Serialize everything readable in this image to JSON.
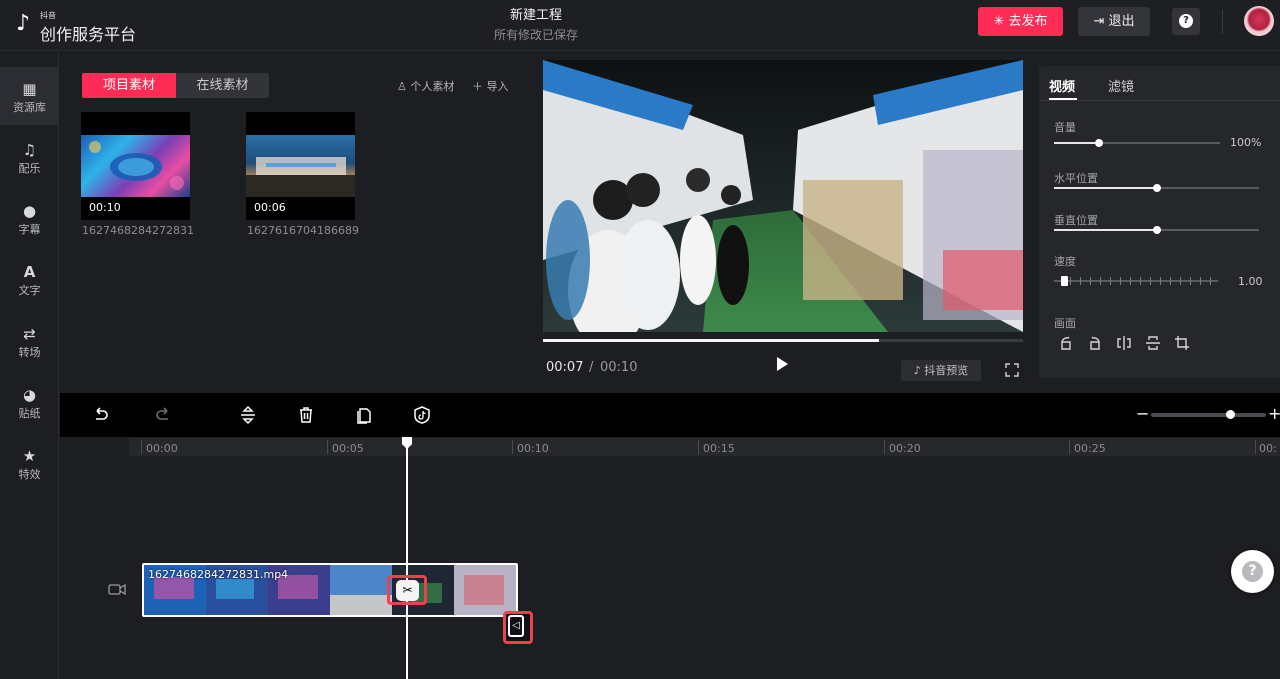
{
  "header": {
    "logo_small": "抖音",
    "logo_text": "创作服务平台",
    "project_title": "新建工程",
    "save_status": "所有修改已保存",
    "publish_label": "去发布",
    "exit_label": "退出",
    "help_glyph": "?",
    "accent_color": "#fe2c55"
  },
  "sidebar": {
    "items": [
      {
        "label": "资源库",
        "icon": "grid-icon"
      },
      {
        "label": "配乐",
        "icon": "music-icon"
      },
      {
        "label": "字幕",
        "icon": "subtitle-icon"
      },
      {
        "label": "文字",
        "icon": "text-icon"
      },
      {
        "label": "转场",
        "icon": "transition-icon"
      },
      {
        "label": "贴纸",
        "icon": "sticker-icon"
      },
      {
        "label": "特效",
        "icon": "effects-icon"
      }
    ]
  },
  "materials": {
    "tabs": [
      "项目素材",
      "在线素材"
    ],
    "personal_label": "个人素材",
    "import_label": "导入",
    "items": [
      {
        "duration": "00:10",
        "name": "1627468284272831"
      },
      {
        "duration": "00:06",
        "name": "1627616704186689"
      }
    ]
  },
  "preview": {
    "current_time": "00:07",
    "separator": "/",
    "total_time": "00:10",
    "progress": 0.7,
    "douyin_preview_label": "抖音预览"
  },
  "properties": {
    "tabs": [
      "视频",
      "滤镜"
    ],
    "volume_label": "音量",
    "volume_value": "100%",
    "volume_level": 0.27,
    "hpos_label": "水平位置",
    "hpos_level": 0.5,
    "vpos_label": "垂直位置",
    "vpos_level": 0.5,
    "speed_label": "速度",
    "speed_value": "1.00",
    "frame_label": "画面"
  },
  "timeline": {
    "ticks": [
      "00:00",
      "00:05",
      "00:10",
      "00:15",
      "00:20",
      "00:25",
      "00:"
    ],
    "clip_name": "1627468284272831.mp4",
    "split_glyph": "✂",
    "zoom_minus": "−",
    "zoom_plus": "+"
  }
}
